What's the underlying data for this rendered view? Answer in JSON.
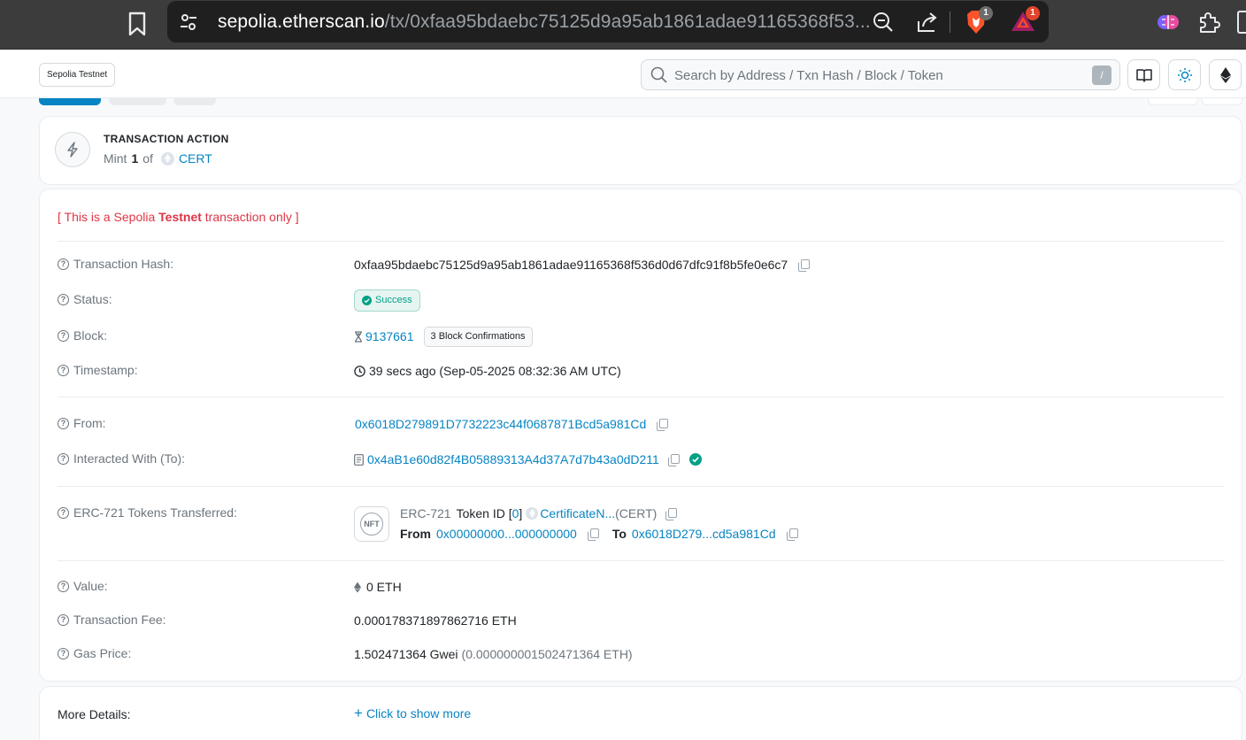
{
  "browser": {
    "url_host": "sepolia.etherscan.io",
    "url_path": "/tx/0xfaa95bdaebc75125d9a95ab1861adae91165368f53...",
    "brave_badge": "1",
    "rewards_badge": "1"
  },
  "header": {
    "network_label": "Sepolia Testnet",
    "search_placeholder": "Search by Address / Txn Hash / Block / Token",
    "search_shortcut": "/"
  },
  "action": {
    "title": "TRANSACTION ACTION",
    "verb": "Mint",
    "count": "1",
    "of": "of",
    "token": "CERT"
  },
  "notice": {
    "prefix": "[ This is a Sepolia ",
    "bold": "Testnet",
    "suffix": " transaction only ]"
  },
  "details": {
    "tx_hash_label": "Transaction Hash:",
    "tx_hash": "0xfaa95bdaebc75125d9a95ab1861adae91165368f536d0d67dfc91f8b5fe0e6c7",
    "status_label": "Status:",
    "status": "Success",
    "block_label": "Block:",
    "block": "9137661",
    "confirmations": "3 Block Confirmations",
    "timestamp_label": "Timestamp:",
    "timestamp": "39 secs ago (Sep-05-2025 08:32:36 AM UTC)",
    "from_label": "From:",
    "from": "0x6018D279891D7732223c44f0687871Bcd5a981Cd",
    "to_label": "Interacted With (To):",
    "to": "0x4aB1e60d82f4B05889313A4d37A7d7b43a0dD211",
    "erc721_label": "ERC-721 Tokens Transferred:",
    "erc721_std": "ERC-721",
    "token_id_label": "Token ID [",
    "token_id": "0",
    "token_id_close": "]",
    "token_name": "CertificateN...",
    "token_symbol": "(CERT)",
    "transfer_from_label": "From",
    "transfer_from": "0x00000000...000000000",
    "transfer_to_label": "To",
    "transfer_to": "0x6018D279...cd5a981Cd",
    "nft_icon_text": "NFT",
    "value_label": "Value:",
    "value": "0 ETH",
    "fee_label": "Transaction Fee:",
    "fee": "0.000178371897862716 ETH",
    "gas_label": "Gas Price:",
    "gas_gwei": "1.502471364 Gwei",
    "gas_eth": "(0.000000001502471364 ETH)"
  },
  "more": {
    "label": "More Details:",
    "action": "Click to show more"
  },
  "colors": {
    "link": "#0784c3",
    "success": "#00a186",
    "danger": "#dc3545"
  }
}
